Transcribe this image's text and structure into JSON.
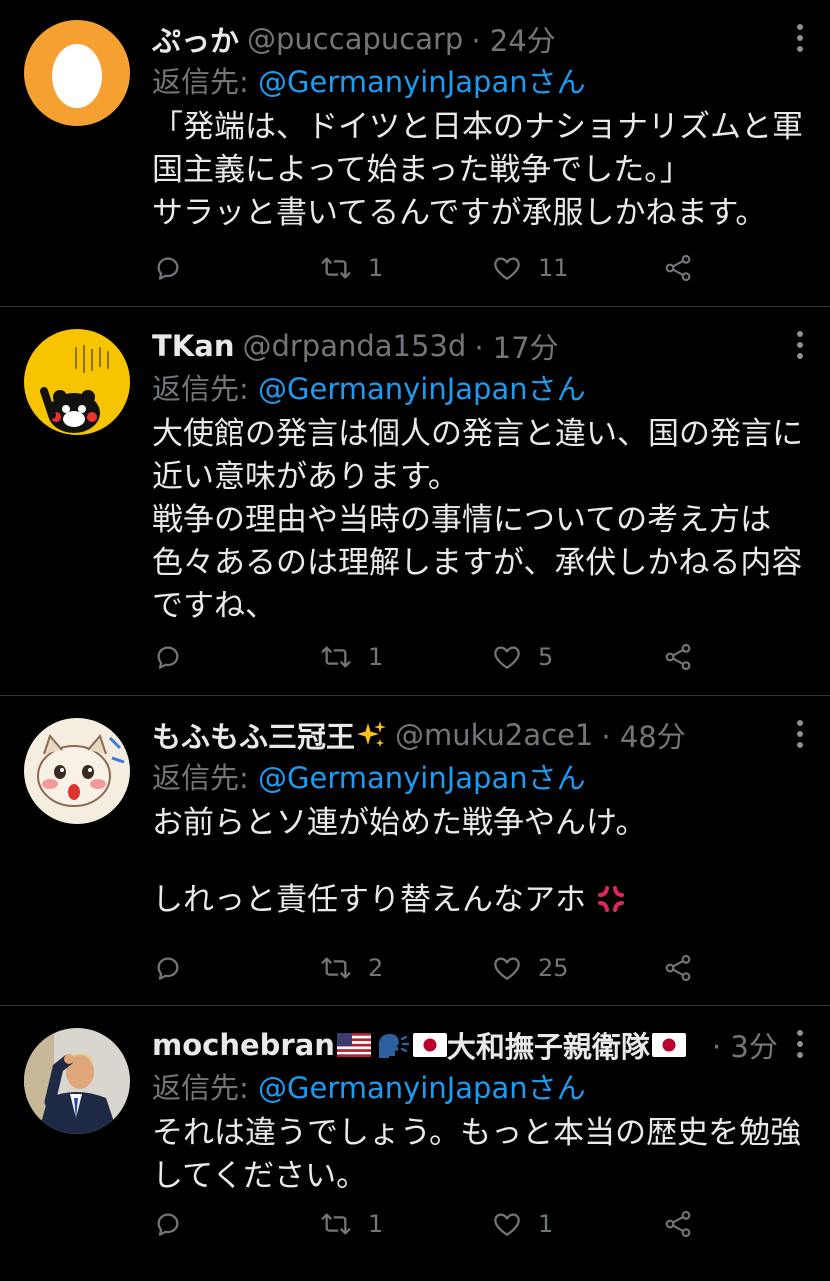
{
  "reply_prefix": "返信先:",
  "reply_suffix": "さん",
  "tweets": [
    {
      "name": "ぷっか",
      "handle": "@puccapucarp",
      "time": "· 24分",
      "mention": "@GermanyinJapan",
      "lines": [
        "「発端は、ドイツと日本のナショナリズムと軍",
        "国主義によって始まった戦争でした。」",
        "サラッと書いてるんですが承服しかねます。"
      ],
      "retweets": "1",
      "likes": "11",
      "avatar_icon": "egg-avatar",
      "avatar_color": "#f5a030"
    },
    {
      "name": "TKan",
      "handle": "@drpanda153d",
      "time": "· 17分",
      "mention": "@GermanyinJapan",
      "lines": [
        "大使館の発言は個人の発言と違い、国の発言に",
        "近い意味があります。",
        "戦争の理由や当時の事情についての考え方は",
        "色々あるのは理解しますが、承伏しかねる内容",
        "ですね、"
      ],
      "retweets": "1",
      "likes": "5",
      "avatar_icon": "kumamon-avatar",
      "avatar_color": "#f6c500"
    },
    {
      "name": "もふもふ三冠王",
      "name_emoji": "sparkles",
      "handle": "@muku2ace1",
      "time": "· 48分",
      "mention": "@GermanyinJapan",
      "lines": [
        "お前らとソ連が始めた戦争やんけ。",
        "",
        "しれっと責任すり替えんなアホ"
      ],
      "end_emoji": "anger",
      "retweets": "2",
      "likes": "25",
      "avatar_icon": "cat-drawing-avatar",
      "avatar_color": "#f4ede0"
    },
    {
      "name": "mochebran",
      "name_suffix": "大和撫子親衛隊",
      "time": "· 3分",
      "mention": "@GermanyinJapan",
      "lines": [
        "それは違うでしょう。もっと本当の歴史を勉強",
        "してください。"
      ],
      "retweets": "1",
      "likes": "1",
      "avatar_icon": "saluting-man-avatar",
      "avatar_color": "#1e2a45"
    }
  ],
  "colors": {
    "accent": "#1d9bf0",
    "muted": "#71767b",
    "background": "#000000"
  }
}
